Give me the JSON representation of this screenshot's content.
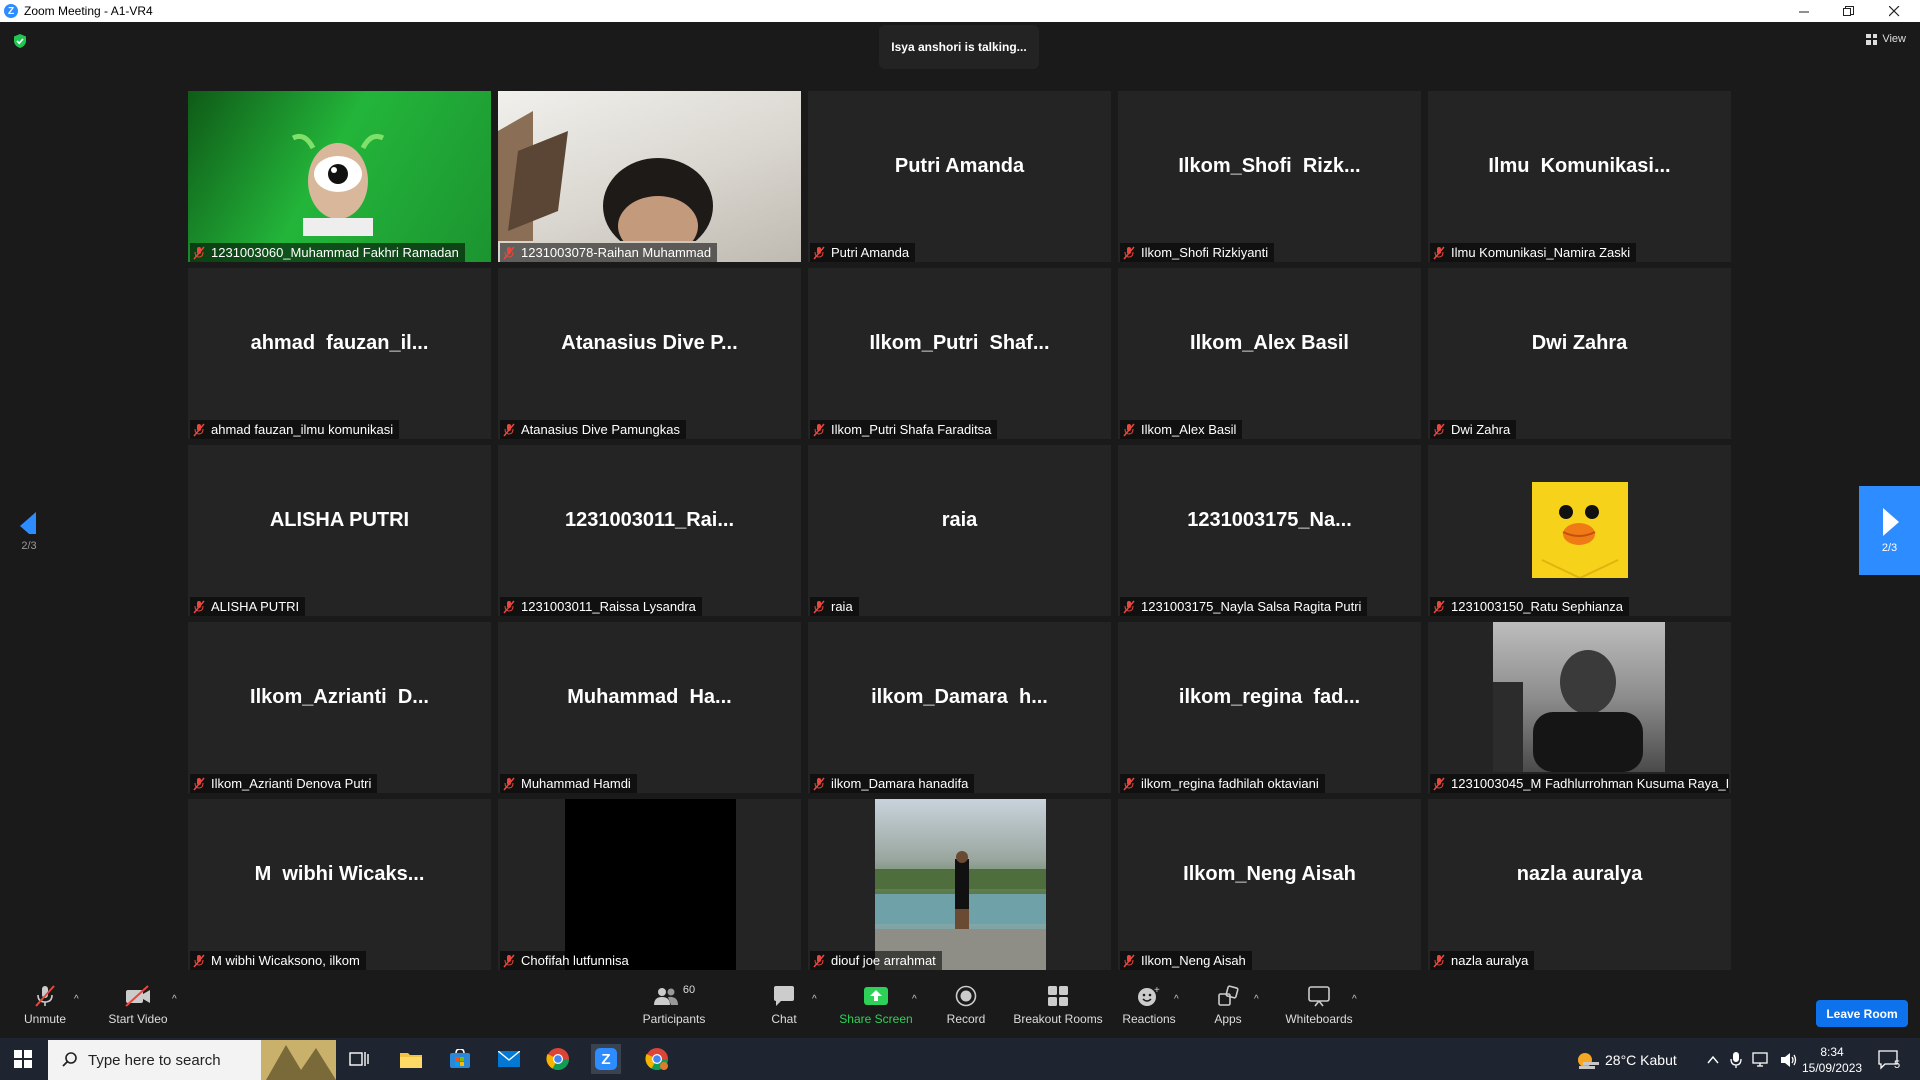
{
  "window": {
    "title": "Zoom Meeting - A1-VR4",
    "logo_letter": "Z"
  },
  "meeting": {
    "talking_banner": "Isya anshori is talking...",
    "view_label": "View",
    "page_left": "2/3",
    "page_right": "2/3"
  },
  "tiles": [
    {
      "big": "",
      "label": "1231003060_Muhammad Fakhri Ramadan"
    },
    {
      "big": "",
      "label": "1231003078-Raihan Muhammad"
    },
    {
      "big": "Putri Amanda",
      "label": "Putri Amanda"
    },
    {
      "big": "Ilkom_Shofi  Rizk...",
      "label": "Ilkom_Shofi Rizkiyanti"
    },
    {
      "big": "Ilmu  Komunikasi...",
      "label": "Ilmu Komunikasi_Namira Zaski"
    },
    {
      "big": "ahmad  fauzan_il...",
      "label": "ahmad fauzan_ilmu komunikasi"
    },
    {
      "big": "Atanasius Dive P...",
      "label": "Atanasius Dive Pamungkas"
    },
    {
      "big": "Ilkom_Putri  Shaf...",
      "label": "Ilkom_Putri Shafa Faraditsa"
    },
    {
      "big": "Ilkom_Alex Basil",
      "label": "Ilkom_Alex Basil"
    },
    {
      "big": "Dwi Zahra",
      "label": "Dwi Zahra"
    },
    {
      "big": "ALISHA PUTRI",
      "label": "ALISHA PUTRI"
    },
    {
      "big": "1231003011_Rai...",
      "label": "1231003011_Raissa Lysandra"
    },
    {
      "big": "raia",
      "label": "raia"
    },
    {
      "big": "1231003175_Na...",
      "label": "1231003175_Nayla Salsa Ragita Putri"
    },
    {
      "big": "",
      "label": "1231003150_Ratu Sephianza"
    },
    {
      "big": "Ilkom_Azrianti  D...",
      "label": "Ilkom_Azrianti Denova Putri"
    },
    {
      "big": "Muhammad  Ha...",
      "label": "Muhammad Hamdi"
    },
    {
      "big": "ilkom_Damara  h...",
      "label": "ilkom_Damara hanadifa"
    },
    {
      "big": "ilkom_regina  fad...",
      "label": "ilkom_regina fadhilah oktaviani"
    },
    {
      "big": "",
      "label": "1231003045_M Fadhlurrohman Kusuma Raya_I..."
    },
    {
      "big": "M  wibhi Wicaks...",
      "label": "M wibhi Wicaksono, ilkom"
    },
    {
      "big": "",
      "label": "Chofifah lutfunnisa"
    },
    {
      "big": "",
      "label": "diouf joe arrahmat"
    },
    {
      "big": "Ilkom_Neng Aisah",
      "label": "Ilkom_Neng Aisah"
    },
    {
      "big": "nazla auralya",
      "label": "nazla auralya"
    }
  ],
  "toolbar": {
    "unmute": "Unmute",
    "start_video": "Start Video",
    "participants": "Participants",
    "participants_count": "60",
    "chat": "Chat",
    "share_screen": "Share Screen",
    "record": "Record",
    "breakout_rooms": "Breakout Rooms",
    "reactions": "Reactions",
    "apps": "Apps",
    "whiteboards": "Whiteboards",
    "leave_room": "Leave Room",
    "share_color": "#2ed158",
    "leave_color": "#0e72ed"
  },
  "taskbar": {
    "search_placeholder": "Type here to search",
    "weather": "28°C  Kabut",
    "time": "8:34",
    "date": "15/09/2023",
    "notifications": "5"
  }
}
